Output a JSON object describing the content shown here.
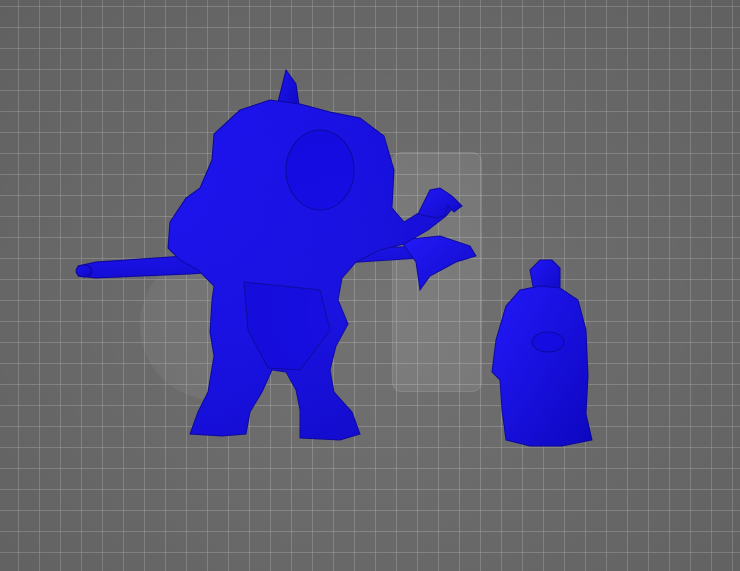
{
  "viewport": {
    "background_color": "#6b6b6b",
    "grid_color": "#a0a0a0",
    "selection_color": "#0a00ff"
  },
  "models": [
    {
      "name": "horned-brute-with-spear",
      "color": "#0a00ff",
      "selected": true
    },
    {
      "name": "robed-monk",
      "color": "#0a00ff",
      "selected": true
    }
  ]
}
